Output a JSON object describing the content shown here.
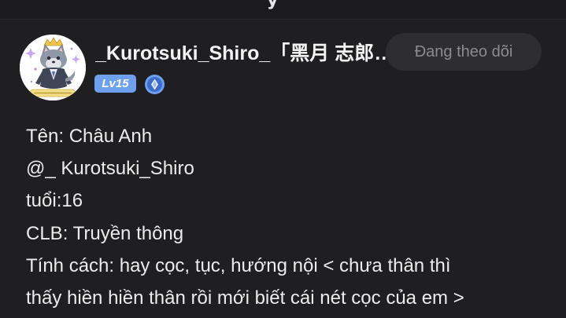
{
  "header": {
    "partial_title_char": "y"
  },
  "post": {
    "username": "_Kurotsuki_Shiro_「黑月 志郎…",
    "follow_button_label": "Đang theo dõi",
    "level_badge": "Lv15",
    "bio_lines": [
      "Tên: Châu Anh",
      "@_ Kurotsuki_Shiro",
      "tuổi:16",
      "CLB: Truyền thông",
      "Tính cách: hay cọc, tục, hướng nội < chưa thân thì",
      "thấy hiền hiền thân rồi mới biết cái nét cọc của em >"
    ]
  },
  "colors": {
    "background": "#1f1f21",
    "follow_button_bg": "#2e2e30",
    "follow_button_text": "#8c8c8e",
    "level_badge_bg": "#6fa0ee",
    "rank_icon": "#6fa0ee"
  },
  "icons": {
    "avatar": "anime-wolf-avatar",
    "rank": "blue-rank-badge-icon"
  }
}
